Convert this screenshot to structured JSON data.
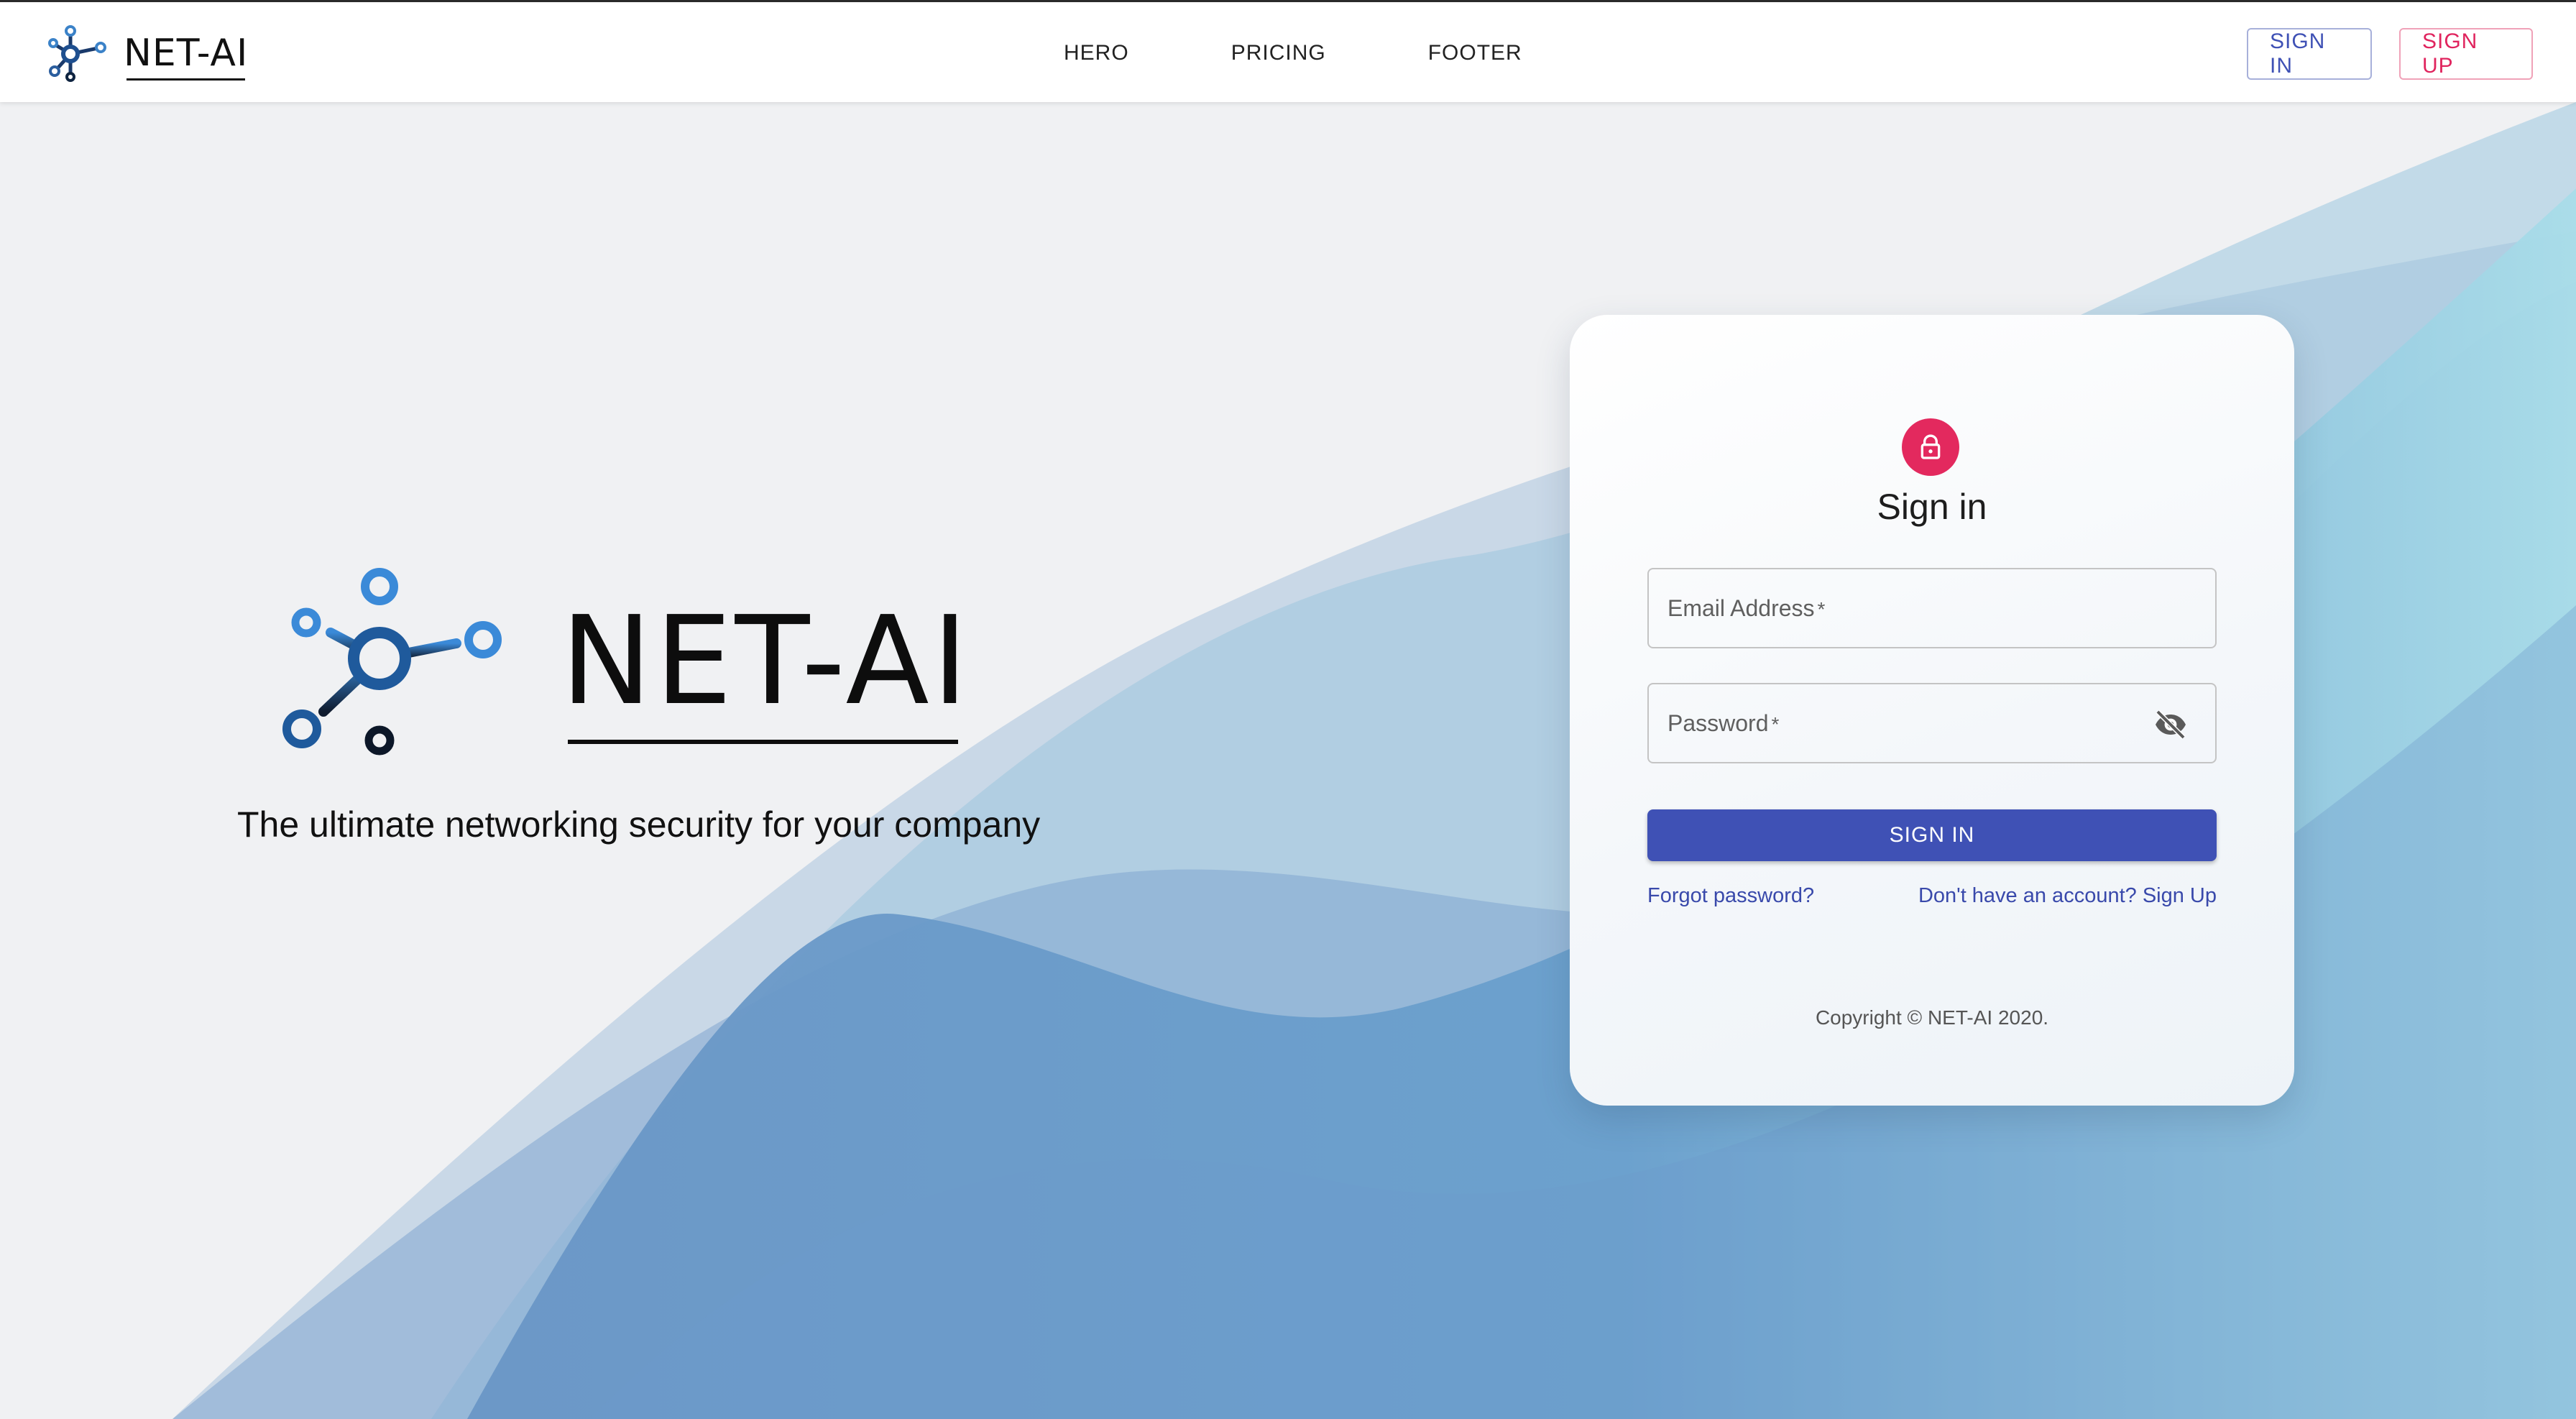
{
  "brand": {
    "name": "NET-AI"
  },
  "nav": {
    "items": [
      "HERO",
      "PRICING",
      "FOOTER"
    ]
  },
  "header": {
    "signin_label": "SIGN IN",
    "signup_label": "SIGN UP"
  },
  "hero": {
    "title": "NET-AI",
    "tagline": "The ultimate networking security for your company"
  },
  "signin_form": {
    "title": "Sign in",
    "email_label": "Email Address",
    "password_label": "Password",
    "required_marker": "*",
    "submit_label": "SIGN IN",
    "forgot_link": "Forgot password?",
    "signup_link": "Don't have an account? Sign Up",
    "copyright": "Copyright © NET-AI 2020."
  },
  "icons": {
    "brand": "network-node-icon",
    "avatar": "lock-icon",
    "password_toggle": "eye-off-icon"
  },
  "colors": {
    "primary": "#3f51b5",
    "secondary": "#e0245e",
    "background": "#f0f1f3",
    "wave_light": "#a8dde9",
    "wave_dark": "#5c93c7"
  }
}
